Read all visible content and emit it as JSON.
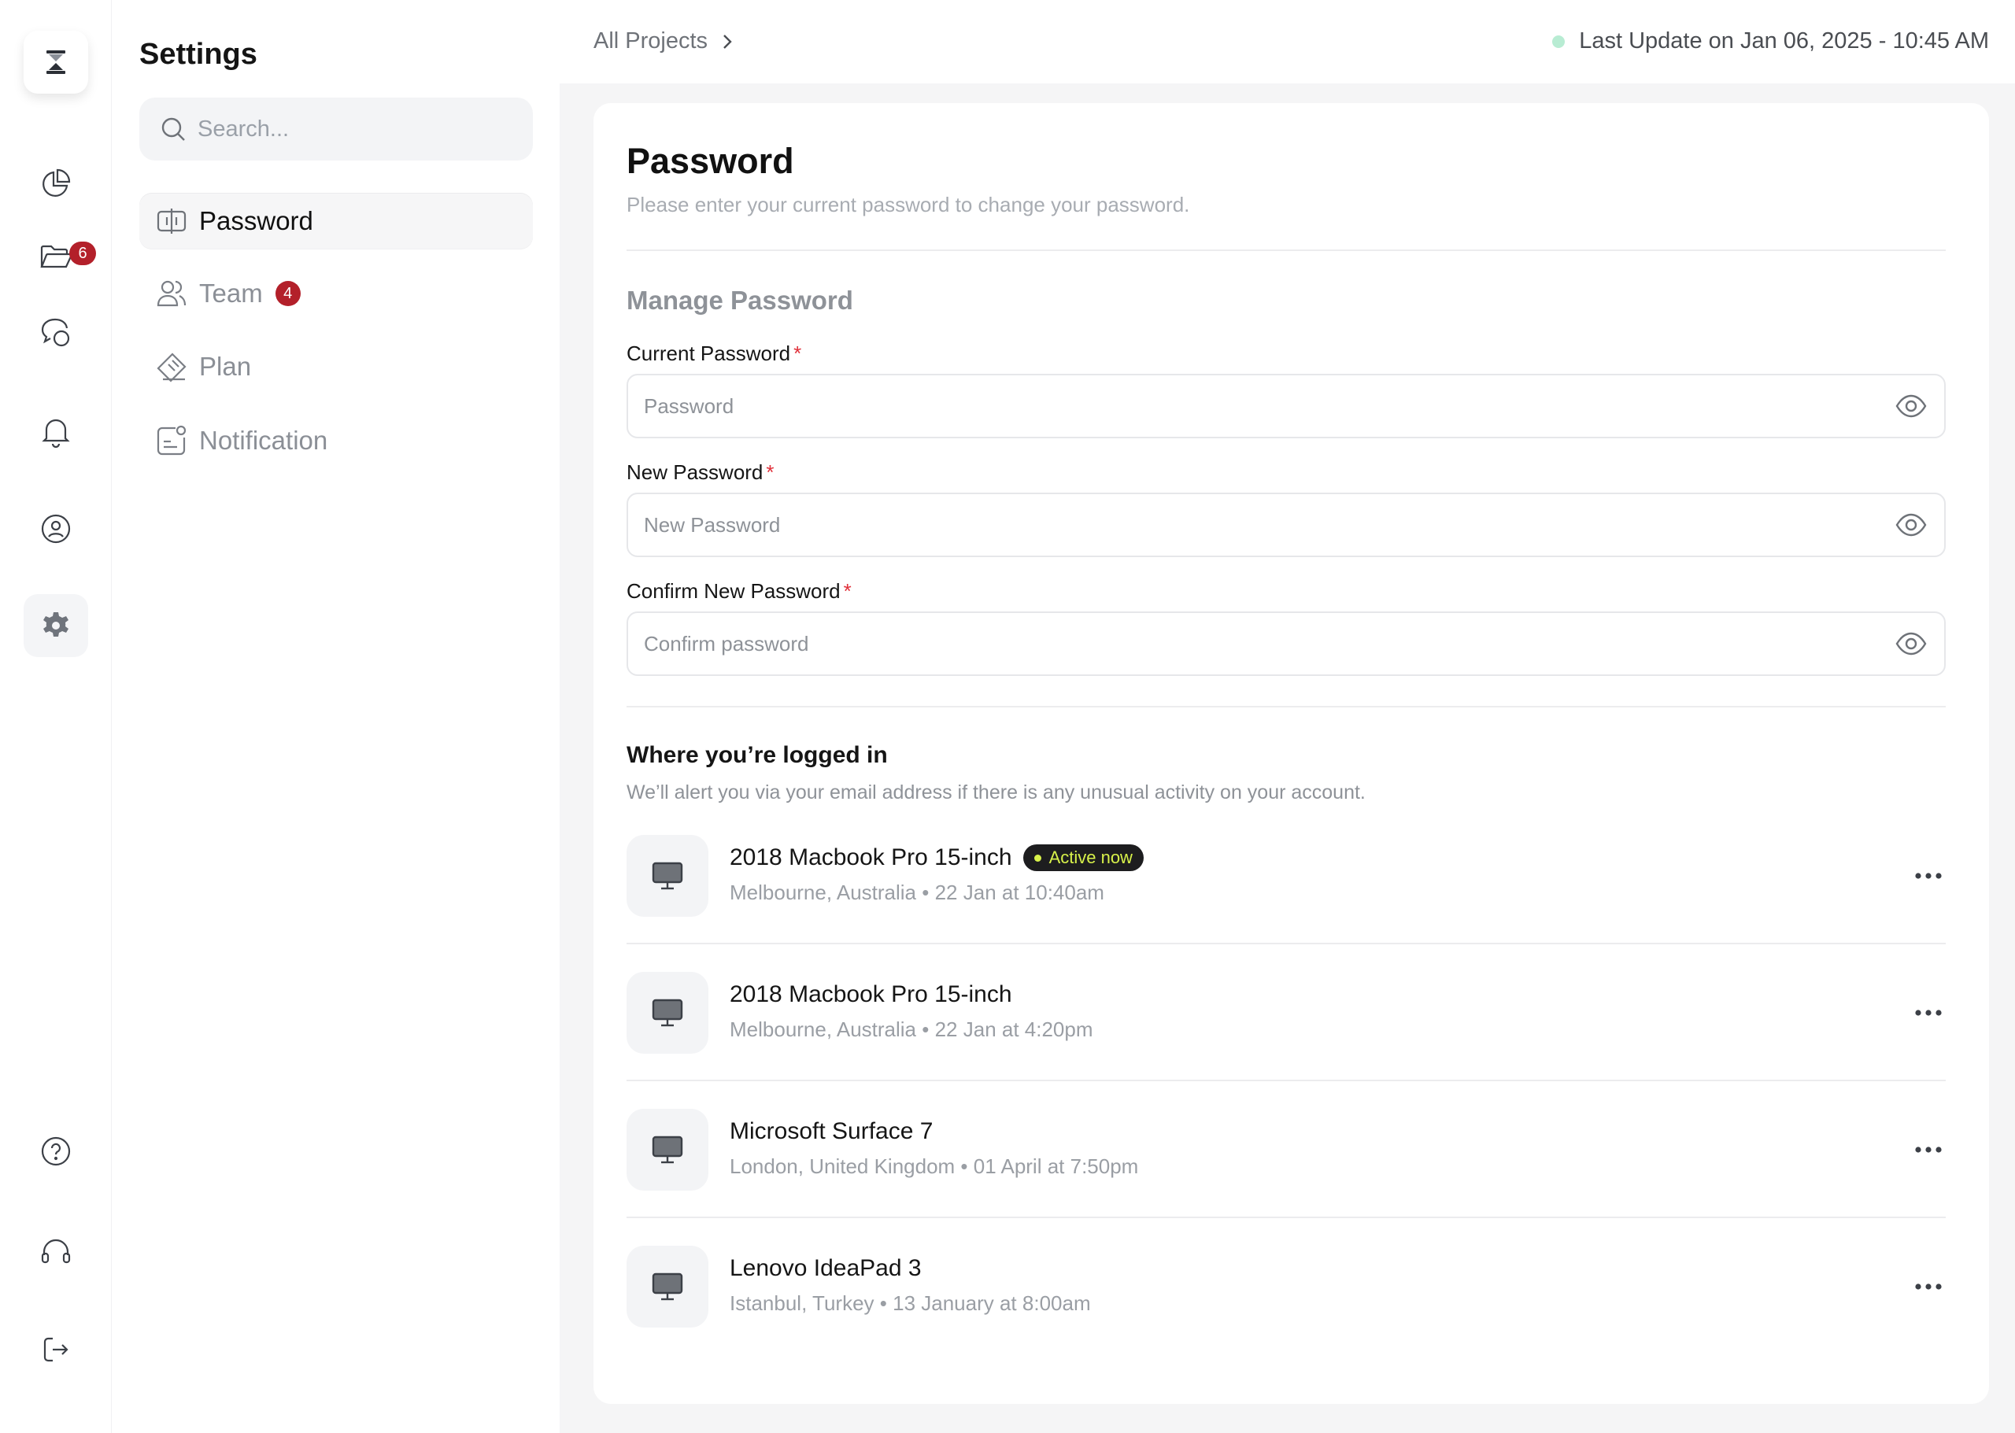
{
  "rail": {
    "folder_badge": "6",
    "icons": [
      "hourglass-icon",
      "pie-chart-icon",
      "folder-icon",
      "chat-icon",
      "bell-icon",
      "user-circle-icon",
      "gear-icon",
      "help-icon",
      "headset-icon",
      "logout-icon"
    ]
  },
  "sidebar": {
    "title": "Settings",
    "search_placeholder": "Search...",
    "items": [
      {
        "label": "Password",
        "icon": "password-icon",
        "active": true
      },
      {
        "label": "Team",
        "icon": "team-icon",
        "badge": "4"
      },
      {
        "label": "Plan",
        "icon": "ticket-icon"
      },
      {
        "label": "Notification",
        "icon": "notification-icon"
      }
    ]
  },
  "topbar": {
    "breadcrumb": "All Projects",
    "last_update": "Last Update on Jan 06, 2025 - 10:45 AM"
  },
  "page": {
    "title": "Password",
    "subtitle": "Please enter your current password to change your password.",
    "section_title": "Manage Password",
    "fields": [
      {
        "label": "Current Password",
        "required_mark": "*",
        "placeholder": "Password"
      },
      {
        "label": "New Password",
        "required_mark": "*",
        "placeholder": "New Password"
      },
      {
        "label": "Confirm New Password",
        "required_mark": "*",
        "placeholder": "Confirm password"
      }
    ],
    "logins": {
      "title": "Where you’re logged in",
      "subtitle": "We’ll alert you via your email address if there is any unusual activity on your account.",
      "active_label": "Active now",
      "devices": [
        {
          "name": "2018 Macbook Pro 15-inch",
          "location": "Melbourne, Australia",
          "time": "22 Jan at 10:40am",
          "active": true
        },
        {
          "name": "2018 Macbook Pro 15-inch",
          "location": "Melbourne, Australia",
          "time": "22 Jan at 4:20pm"
        },
        {
          "name": "Microsoft Surface 7",
          "location": "London, United Kingdom",
          "time": "01 April at 7:50pm"
        },
        {
          "name": "Lenovo IdeaPad 3",
          "location": "Istanbul, Turkey",
          "time": "13 January at 8:00am"
        }
      ]
    }
  },
  "colors": {
    "badge_red": "#b3202a",
    "required_red": "#e0303a",
    "status_green": "#b8ecd3",
    "active_lime": "#d8f24a"
  }
}
